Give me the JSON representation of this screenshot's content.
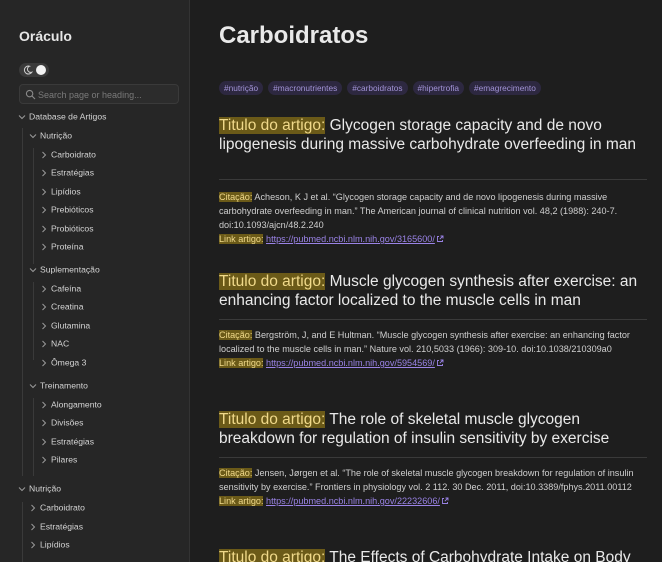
{
  "sidebar": {
    "site_name": "Oráculo",
    "search_placeholder": "Search page or heading...",
    "tree": [
      {
        "label": "Database de Artigos",
        "level": 0
      },
      {
        "label": "Nutrição",
        "level": 1
      },
      {
        "label": "Carboidrato",
        "level": 2
      },
      {
        "label": "Estratégias",
        "level": 2
      },
      {
        "label": "Lipídios",
        "level": 2
      },
      {
        "label": "Prebióticos",
        "level": 2
      },
      {
        "label": "Probióticos",
        "level": 2
      },
      {
        "label": "Proteína",
        "level": 2
      },
      {
        "label": "Suplementação",
        "level": 1
      },
      {
        "label": "Cafeína",
        "level": 2
      },
      {
        "label": "Creatina",
        "level": 2
      },
      {
        "label": "Glutamina",
        "level": 2
      },
      {
        "label": "NAC",
        "level": 2
      },
      {
        "label": "Ômega 3",
        "level": 2
      },
      {
        "label": "Treinamento",
        "level": 1
      },
      {
        "label": "Alongamento",
        "level": 2
      },
      {
        "label": "Divisões",
        "level": 2
      },
      {
        "label": "Estratégias",
        "level": 2
      },
      {
        "label": "Pilares",
        "level": 2
      },
      {
        "label": "Nutrição",
        "level": 0
      },
      {
        "label": "Carboidrato",
        "level": 1
      },
      {
        "label": "Estratégias",
        "level": 1
      },
      {
        "label": "Lipídios",
        "level": 1
      }
    ]
  },
  "main": {
    "title": "Carboidratos",
    "tags": [
      "#nutrição",
      "#macronutrientes",
      "#carboidratos",
      "#hipertrofia",
      "#emagrecimento"
    ],
    "labels": {
      "title_key": "Titulo do artigo:",
      "citation_key": "Citação:",
      "link_key": "Link artigo:"
    },
    "articles": [
      {
        "title": "Glycogen storage capacity and de novo lipogenesis during massive carbohydrate overfeeding in man",
        "citation": "Acheson, K J et al. “Glycogen storage capacity and de novo lipogenesis during massive carbohydrate overfeeding in man.” The American journal of clinical nutrition vol. 48,2 (1988): 240-7. doi:10.1093/ajcn/48.2.240",
        "link": "https://pubmed.ncbi.nlm.nih.gov/3165600/"
      },
      {
        "title": "Muscle glycogen synthesis after exercise: an enhancing factor localized to the muscle cells in man",
        "citation": "Bergström, J, and E Hultman. “Muscle glycogen synthesis after exercise: an enhancing factor localized to the muscle cells in man.” Nature vol. 210,5033 (1966): 309-10. doi:10.1038/210309a0",
        "link": "https://pubmed.ncbi.nlm.nih.gov/5954569/"
      },
      {
        "title": "The role of skeletal muscle glycogen breakdown for regulation of insulin sensitivity by exercise",
        "citation": "Jensen, Jørgen et al. “The role of skeletal muscle glycogen breakdown for regulation of insulin sensitivity by exercise.” Frontiers in physiology vol. 2 112. 30 Dec. 2011, doi:10.3389/fphys.2011.00112",
        "link": "https://pubmed.ncbi.nlm.nih.gov/22232606/"
      },
      {
        "title": "The Effects of Carbohydrate Intake on Body",
        "citation": "",
        "link": ""
      }
    ]
  },
  "colors": {
    "background": "#1e1e1e",
    "sidebar": "#262626",
    "highlight": "#6b5a18",
    "tag_bg": "#2d2840",
    "link": "#9a83e6"
  }
}
